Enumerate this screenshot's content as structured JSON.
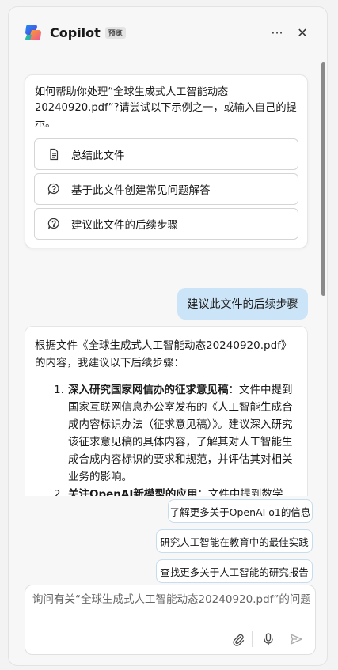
{
  "header": {
    "title": "Copilot",
    "badge": "预览",
    "more_glyph": "···",
    "close_glyph": "✕"
  },
  "prompt_card": {
    "text": "如何帮助你处理“全球生成式人工智能动态20240920.pdf”?请尝试以下示例之一，或输入自己的提示。",
    "chips": [
      {
        "label": "总结此文件",
        "icon": "document-icon"
      },
      {
        "label": "基于此文件创建常见问题解答",
        "icon": "question-bubble-icon"
      },
      {
        "label": "建议此文件的后续步骤",
        "icon": "question-bubble-icon"
      }
    ]
  },
  "user_message": "建议此文件的后续步骤",
  "reply": {
    "intro": "根据文件《全球生成式人工智能动态20240920.pdf》的内容，我建议以下后续步骤：",
    "items": [
      {
        "num": "1.",
        "bold": "深入研究国家网信办的征求意见稿",
        "text": "：文件中提到国家互联网信息办公室发布的《人工智能生成合成内容标识办法（征求意见稿）》。建议深入研究该征求意见稿的具体内容，了解其对人工智能生成合成内容标识的要求和规范，并评估其对相关业务的影响。"
      },
      {
        "num": "2.",
        "bold": "关注OpenAI新模型的应用",
        "text": "：文件中提到数学家"
      }
    ]
  },
  "suggestions": [
    "了解更多关于OpenAI o1的信息",
    "研究人工智能在教育中的最佳实践",
    "查找更多关于人工智能的研究报告"
  ],
  "composer": {
    "placeholder": "询问有关“全球生成式人工智能动态20240920.pdf”的问题"
  },
  "colors": {
    "user_bubble": "#cce4f7",
    "suggestion_border": "#c6dcef",
    "accent": "#0f6cbd"
  }
}
